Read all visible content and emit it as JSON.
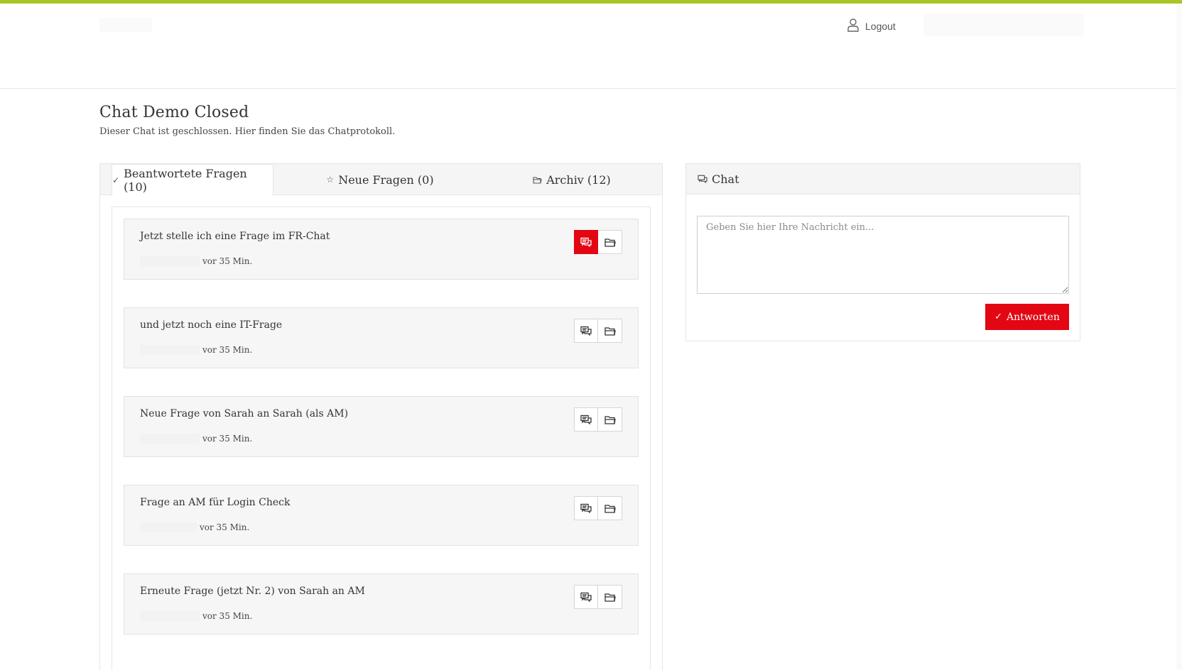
{
  "colors": {
    "accent": "#a8c62a",
    "primary_red": "#e30613",
    "panel_bg": "#f5f5f5"
  },
  "header": {
    "logout_label": "Logout",
    "logout_icon": "user-icon"
  },
  "page": {
    "title": "Chat Demo Closed",
    "subtitle": "Dieser Chat ist geschlossen. Hier finden Sie das Chatprotokoll."
  },
  "tabs": [
    {
      "label": "Beantwortete Fragen (10)",
      "icon": "checkmark-icon",
      "active": true
    },
    {
      "label": "Neue Fragen (0)",
      "icon": "star-icon",
      "active": false
    },
    {
      "label": "Archiv (12)",
      "icon": "folder-icon",
      "active": false
    }
  ],
  "questions": [
    {
      "title": "Jetzt stelle ich eine Frage im FR-Chat",
      "time": "vor 35 Min.",
      "chat_active": true
    },
    {
      "title": "und jetzt noch eine IT-Frage",
      "time": "vor 35 Min.",
      "chat_active": false
    },
    {
      "title": "Neue Frage von Sarah an Sarah (als AM)",
      "time": "vor 35 Min.",
      "chat_active": false
    },
    {
      "title": "Frage an AM für Login Check",
      "time": "vor 35 Min.",
      "chat_active": false
    },
    {
      "title": "Erneute Frage (jetzt Nr. 2) von Sarah an AM",
      "time": "vor 35 Min.",
      "chat_active": false
    }
  ],
  "chat": {
    "header_label": "Chat",
    "header_icon": "chat-bubbles-icon",
    "input_placeholder": "Geben Sie hier Ihre Nachricht ein...",
    "reply_label": "Antworten"
  }
}
